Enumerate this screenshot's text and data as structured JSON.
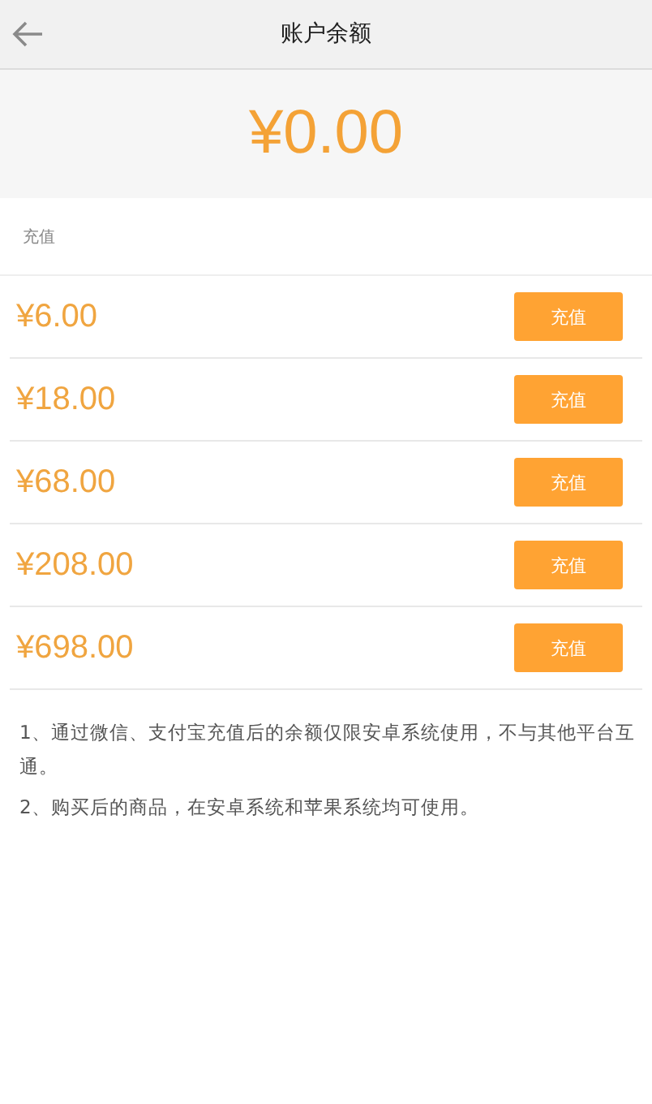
{
  "header": {
    "title": "账户余额"
  },
  "balance": {
    "amount": "¥0.00"
  },
  "section": {
    "label": "充值"
  },
  "options": [
    {
      "amount": "¥6.00",
      "button": "充值"
    },
    {
      "amount": "¥18.00",
      "button": "充值"
    },
    {
      "amount": "¥68.00",
      "button": "充值"
    },
    {
      "amount": "¥208.00",
      "button": "充值"
    },
    {
      "amount": "¥698.00",
      "button": "充值"
    }
  ],
  "notes": [
    "1、通过微信、支付宝充值后的余额仅限安卓系统使用，不与其他平台互通。",
    "2、购买后的商品，在安卓系统和苹果系统均可使用。"
  ]
}
